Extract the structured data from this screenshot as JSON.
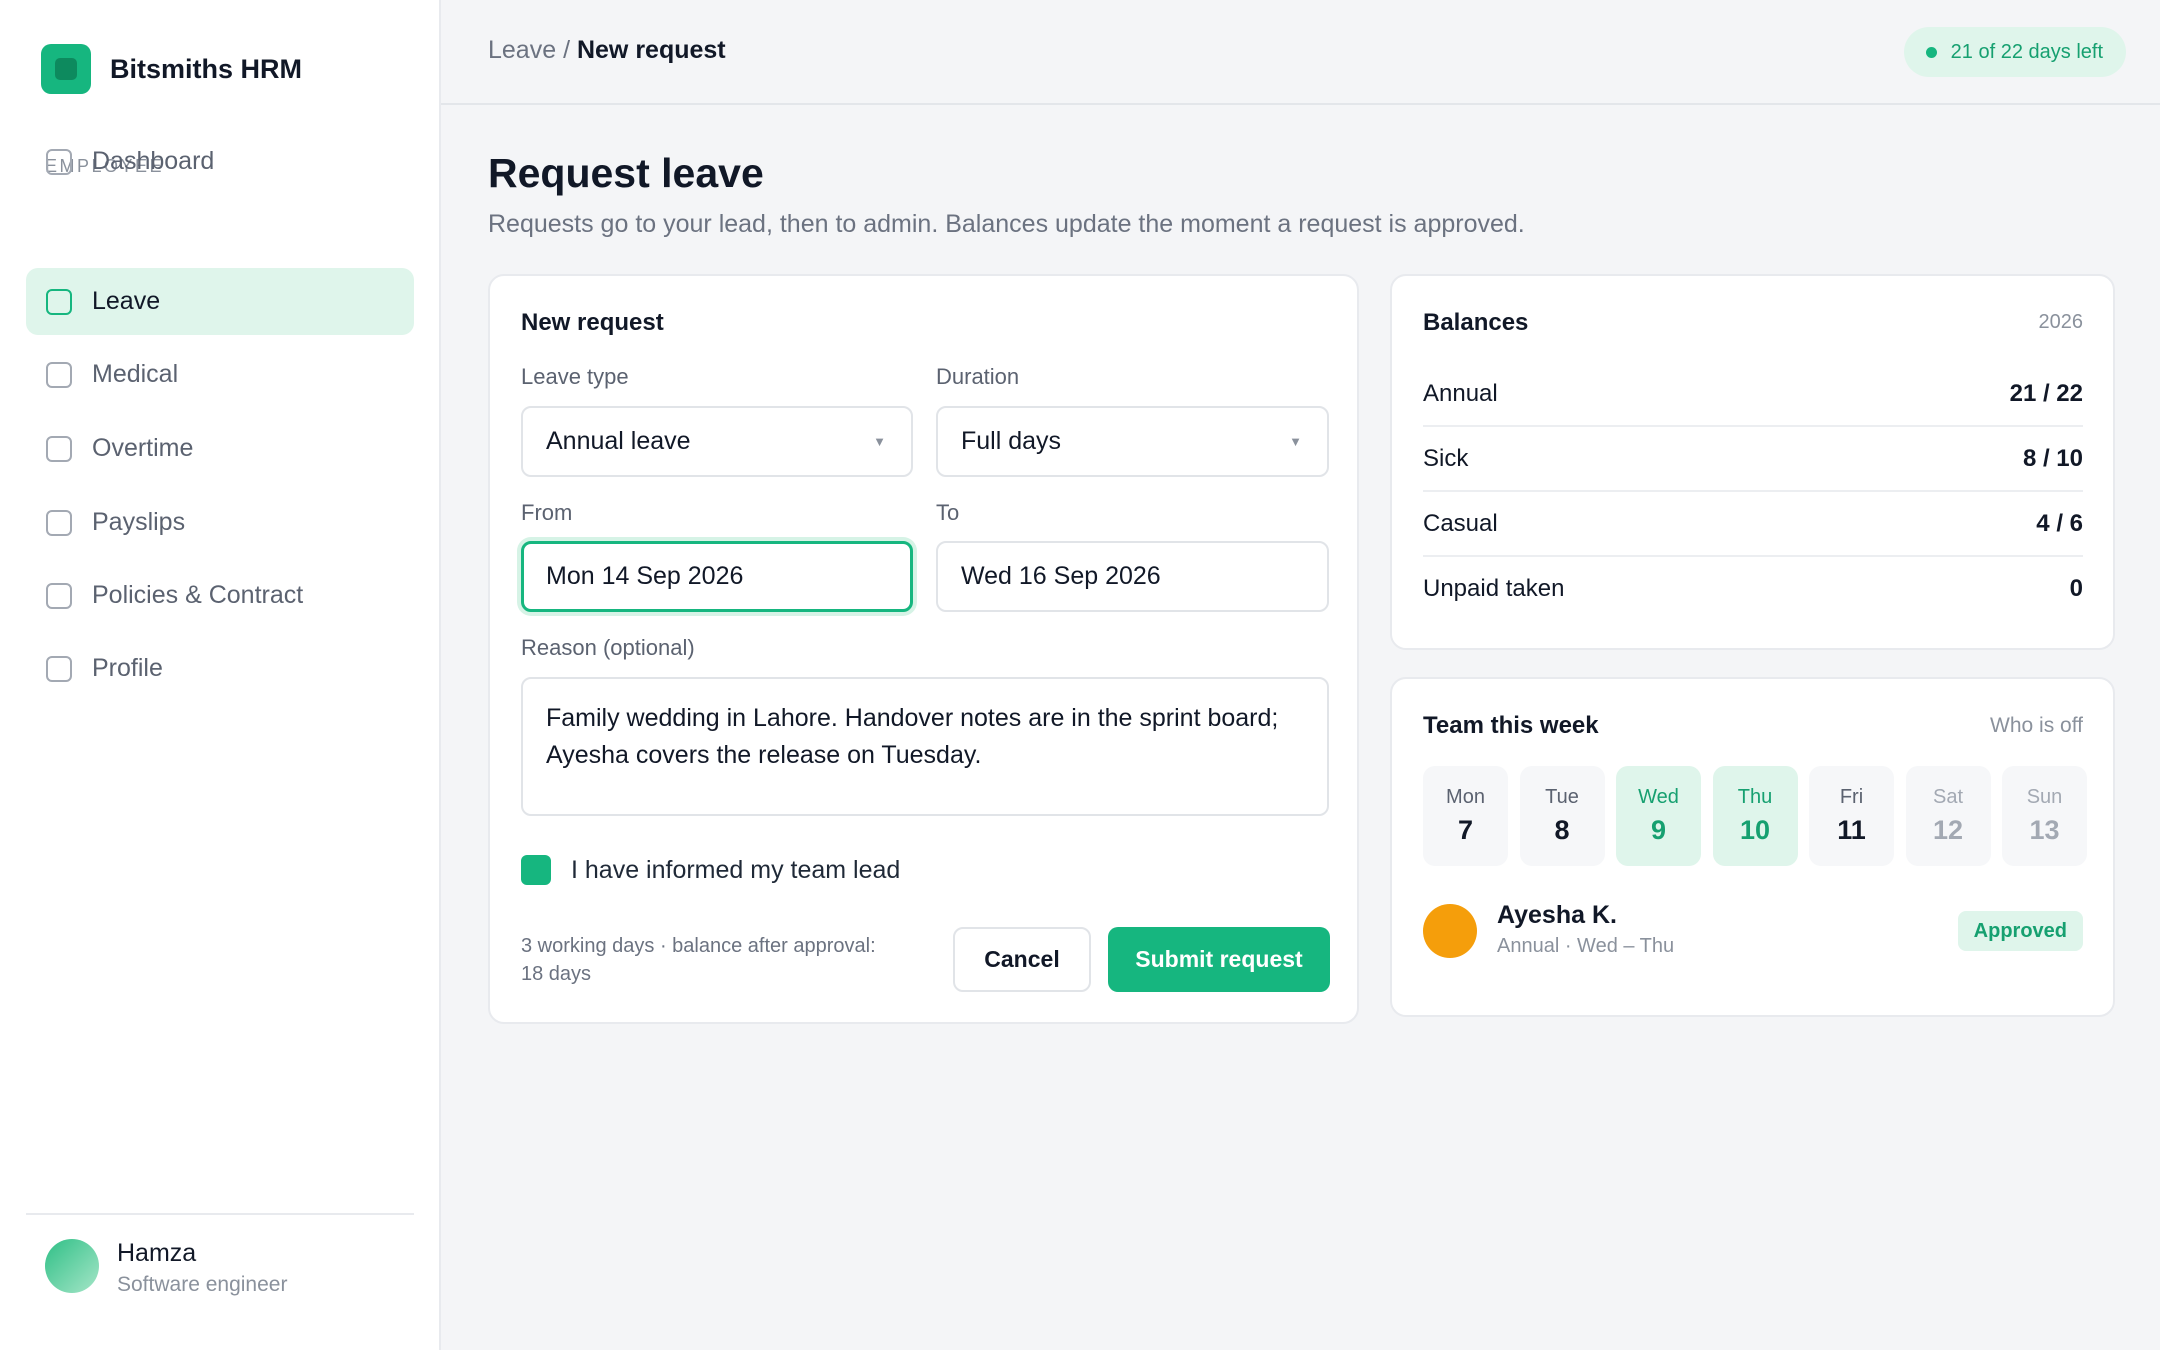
{
  "app": {
    "name": "Bitsmiths HRM"
  },
  "sidebar": {
    "section": "EMPLOYEE",
    "items": [
      {
        "label": "Dashboard"
      },
      {
        "label": "Leave"
      },
      {
        "label": "Medical"
      },
      {
        "label": "Overtime"
      },
      {
        "label": "Payslips"
      },
      {
        "label": "Policies & Contract"
      },
      {
        "label": "Profile"
      }
    ],
    "user": {
      "name": "Hamza",
      "role": "Software engineer"
    }
  },
  "header": {
    "breadcrumb_parent": "Leave",
    "breadcrumb_sep": " / ",
    "breadcrumb_current": "New request",
    "days_left": "21 of 22 days left"
  },
  "page": {
    "title": "Request leave",
    "subtitle": "Requests go to your lead, then to admin. Balances update the moment a request is approved."
  },
  "form": {
    "title": "New request",
    "leave_type_label": "Leave type",
    "leave_type_value": "Annual leave",
    "duration_label": "Duration",
    "duration_value": "Full days",
    "from_label": "From",
    "from_value": "Mon 14 Sep 2026",
    "to_label": "To",
    "to_value": "Wed 16 Sep 2026",
    "reason_label": "Reason (optional)",
    "reason_value": "Family wedding in Lahore. Handover notes are in the sprint board; Ayesha covers the release on Tuesday.",
    "checkbox_label": "I have informed my team lead",
    "summary_line1": "3 working days · balance after approval:",
    "summary_line2": "18 days",
    "cancel": "Cancel",
    "submit": "Submit request"
  },
  "balances": {
    "title": "Balances",
    "year": "2026",
    "rows": [
      {
        "label": "Annual",
        "value": "21 / 22"
      },
      {
        "label": "Sick",
        "value": "8 / 10"
      },
      {
        "label": "Casual",
        "value": "4 / 6"
      },
      {
        "label": "Unpaid taken",
        "value": "0"
      }
    ]
  },
  "team": {
    "title": "Team this week",
    "hint": "Who is off",
    "days": [
      {
        "name": "Mon",
        "date": "7"
      },
      {
        "name": "Tue",
        "date": "8"
      },
      {
        "name": "Wed",
        "date": "9"
      },
      {
        "name": "Thu",
        "date": "10"
      },
      {
        "name": "Fri",
        "date": "11"
      },
      {
        "name": "Sat",
        "date": "12"
      },
      {
        "name": "Sun",
        "date": "13"
      }
    ],
    "member": {
      "name": "Ayesha K.",
      "detail": "Annual · Wed – Thu",
      "status": "Approved"
    }
  },
  "colors": {
    "accent": "#16b67f",
    "accent_soft": "#dff5eb",
    "avatar_member": "#f59e0b"
  }
}
